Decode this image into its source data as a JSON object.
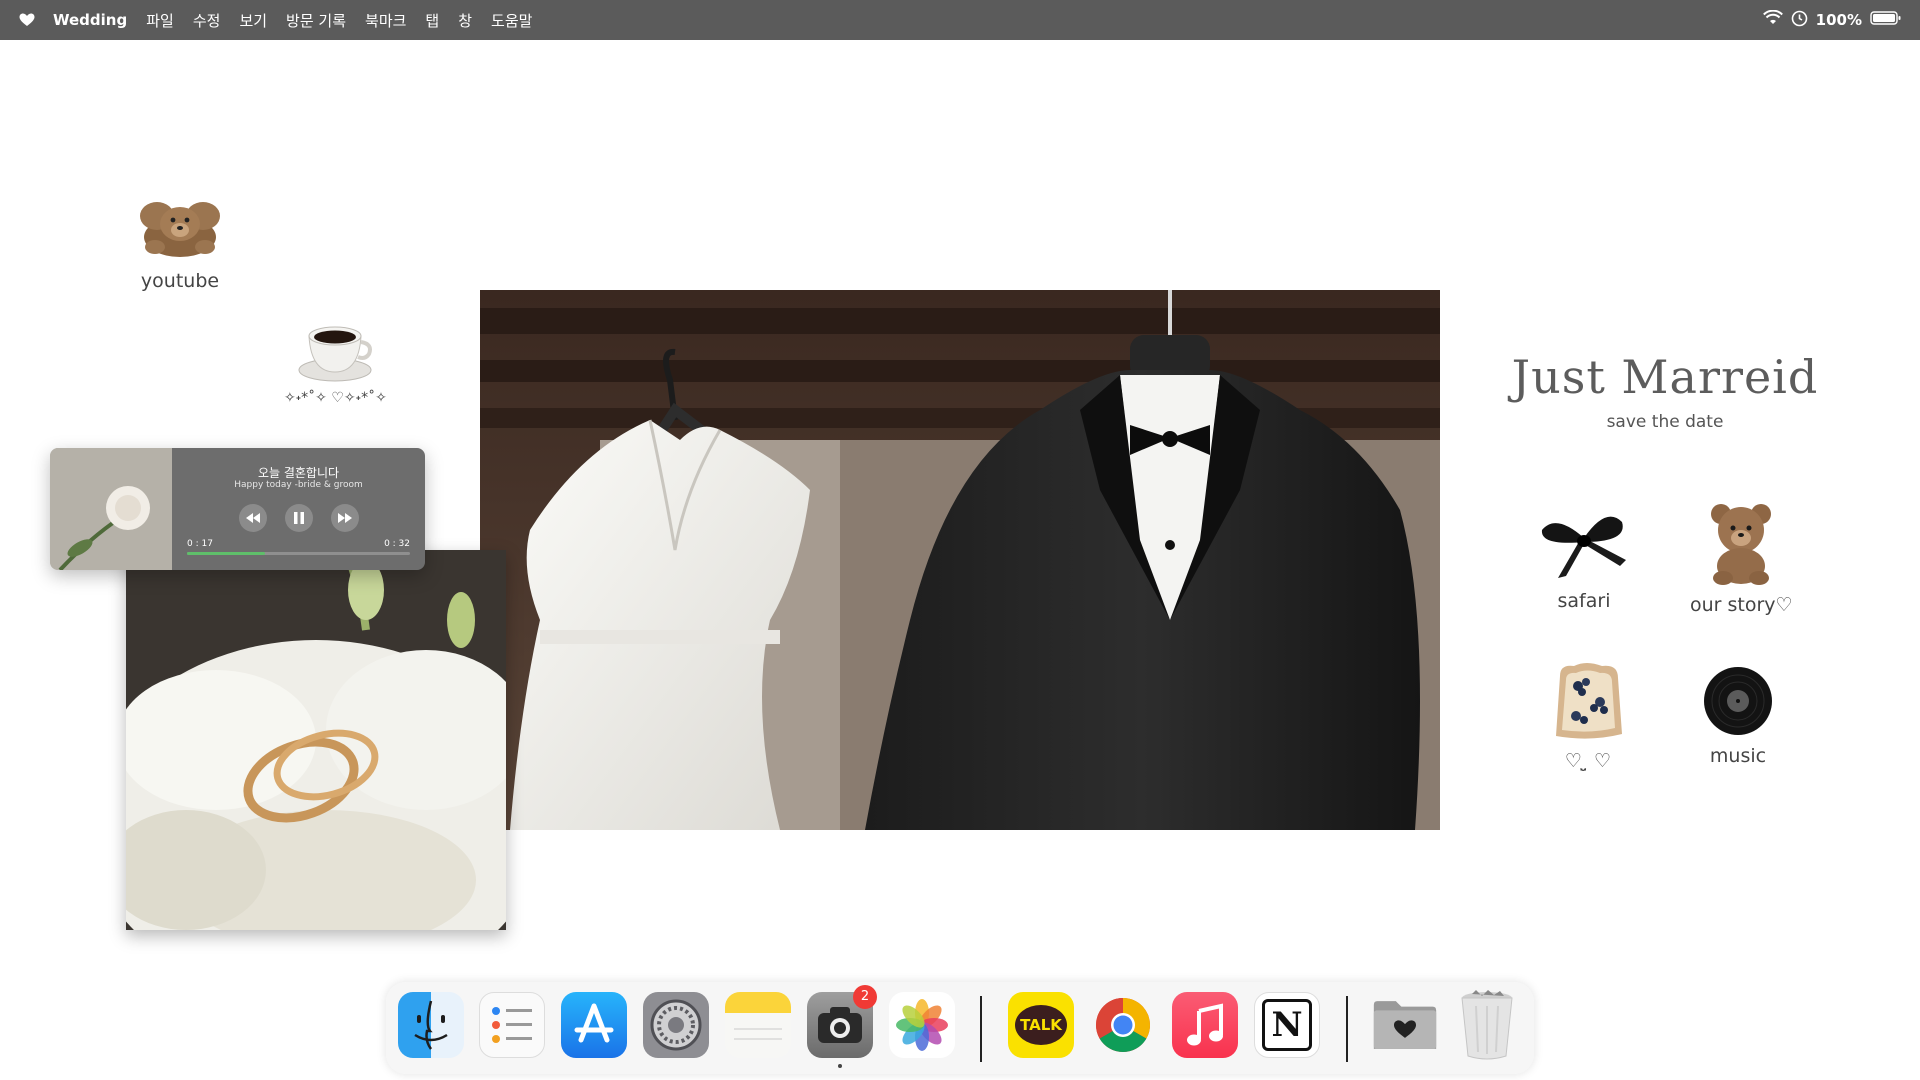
{
  "menubar": {
    "app_name": "Wedding",
    "menus": [
      "파일",
      "수정",
      "보기",
      "방문 기록",
      "북마크",
      "탭",
      "창",
      "도움말"
    ],
    "battery": "100%"
  },
  "desktop": {
    "icons": [
      {
        "label": "youtube",
        "icon": "teddy-bear-icon"
      },
      {
        "label": "✧˖*˚✧ ♡✧˖*˚✧",
        "icon": "coffee-cup-icon"
      },
      {
        "label": "safari",
        "icon": "black-ribbon-icon"
      },
      {
        "label": "our story♡",
        "icon": "teddy-bear-icon"
      },
      {
        "label": "♡ ̤̮ ♡",
        "icon": "toast-icon"
      },
      {
        "label": "music",
        "icon": "vinyl-record-icon"
      }
    ]
  },
  "header": {
    "title": "Just Marreid",
    "subtitle": "save the date"
  },
  "music_player": {
    "song": "오늘 결혼합니다",
    "artist": "Happy today -bride & groom",
    "elapsed": "0 : 17",
    "duration": "0 : 32",
    "progress": 0.35
  },
  "dock": {
    "apps": [
      "finder",
      "reminders",
      "app-store",
      "system-settings",
      "notes",
      "camera",
      "photos",
      "kakaotalk",
      "chrome",
      "music",
      "notion",
      "downloads-folder",
      "trash"
    ],
    "camera_badge": "2",
    "kakao_label": "TALK",
    "notion_label": "N"
  }
}
